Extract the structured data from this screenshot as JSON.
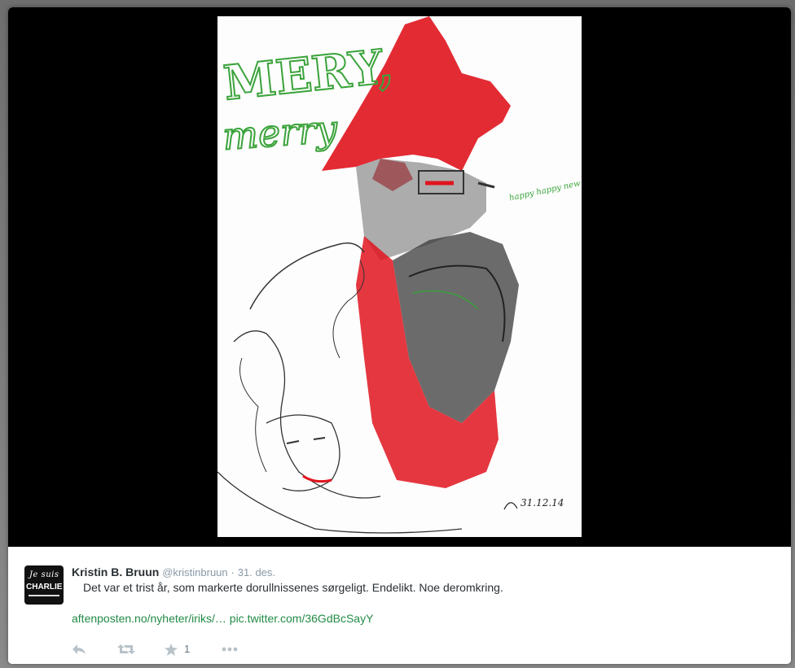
{
  "tweet": {
    "fullname": "Kristin B. Bruun",
    "username": "@kristinbruun",
    "separator": "·",
    "timestamp": "31. des.",
    "text": "Det var et trist år, som markerte dorullnissenes sørgeligt. Endelikt. Noe deromkring.",
    "link1": "aftenposten.no/nyheter/iriks/…",
    "link2": "pic.twitter.com/36GdBcSayY",
    "favorite_count": "1"
  },
  "avatar": {
    "line1": "Je suis",
    "line2": "CHARLIE"
  },
  "media": {
    "drawing_text_1": "MERY,",
    "drawing_text_2": "merry",
    "drawing_note": "happy happy new old ever after",
    "drawing_date": "31.12.14"
  },
  "icons": {
    "reply": "reply-icon",
    "retweet": "retweet-icon",
    "favorite": "star-icon",
    "more": "more-icon"
  },
  "colors": {
    "backdrop": "#000000",
    "link": "#228b46",
    "drawing_red": "#e0141e",
    "drawing_green": "#3aa33a"
  }
}
